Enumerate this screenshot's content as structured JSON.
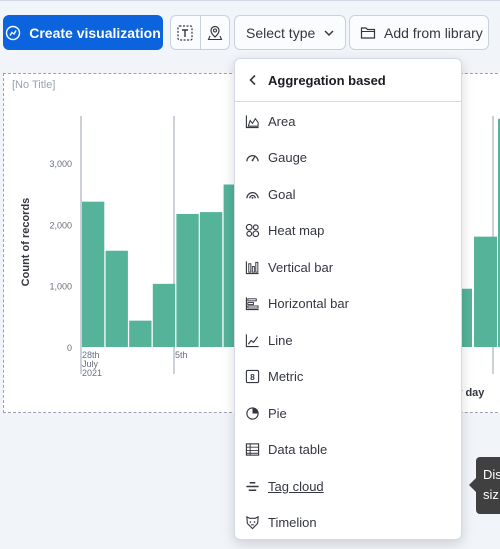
{
  "toolbar": {
    "create_label": "Create visualization",
    "select_type_label": "Select type",
    "add_library_label": "Add from library"
  },
  "panel": {
    "title": "[No Title]",
    "x_label_partial": "er day"
  },
  "chart_data": {
    "type": "bar",
    "ylabel": "Count of records",
    "ylim": [
      0,
      3800
    ],
    "yticks": [
      "0",
      "1,000",
      "2,000",
      "3,000"
    ],
    "grid": false,
    "left_values": [
      2370,
      1570,
      430,
      1030,
      2170,
      2200,
      2650
    ],
    "right_values": [
      950,
      1800,
      3720
    ],
    "x_ticks": [
      {
        "label": "28th",
        "sub": [
          "July",
          "2021"
        ]
      },
      {
        "label": "5th",
        "sub": []
      }
    ],
    "bar_color": "#54b399"
  },
  "dropdown": {
    "title": "Aggregation based",
    "items": [
      {
        "label": "Area",
        "icon": "area-chart-icon"
      },
      {
        "label": "Gauge",
        "icon": "gauge-icon"
      },
      {
        "label": "Goal",
        "icon": "goal-icon"
      },
      {
        "label": "Heat map",
        "icon": "heatmap-icon"
      },
      {
        "label": "Vertical bar",
        "icon": "vertical-bar-icon"
      },
      {
        "label": "Horizontal bar",
        "icon": "horizontal-bar-icon"
      },
      {
        "label": "Line",
        "icon": "line-chart-icon"
      },
      {
        "label": "Metric",
        "icon": "metric-icon"
      },
      {
        "label": "Pie",
        "icon": "pie-chart-icon"
      },
      {
        "label": "Data table",
        "icon": "table-icon"
      },
      {
        "label": "Tag cloud",
        "icon": "tag-cloud-icon"
      },
      {
        "label": "Timelion",
        "icon": "timelion-icon"
      }
    ]
  },
  "tooltip": {
    "line1": "Dis",
    "line2": "siz"
  },
  "colors": {
    "primary": "#0b64dd",
    "bar": "#54b399",
    "background": "#f1f4f9"
  }
}
